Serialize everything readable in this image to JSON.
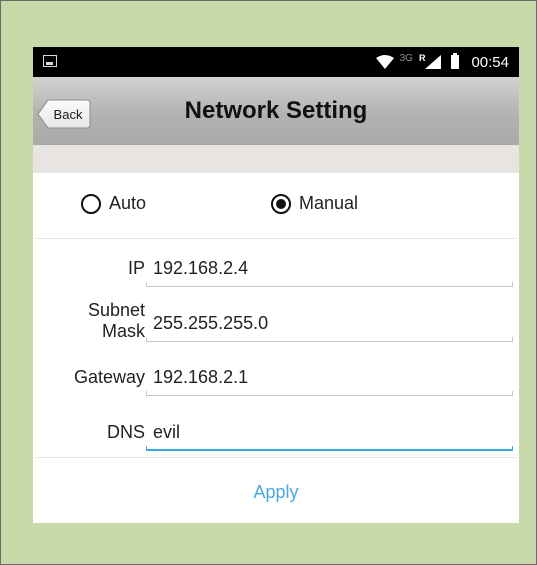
{
  "status_bar": {
    "network_label": "3G",
    "roaming_label": "R",
    "time": "00:54"
  },
  "header": {
    "back_label": "Back",
    "title": "Network Setting"
  },
  "mode": {
    "options": [
      "Auto",
      "Manual"
    ],
    "selected": "Manual"
  },
  "fields": {
    "ip": {
      "label": "IP",
      "value": "192.168.2.4"
    },
    "subnet": {
      "label_line1": "Subnet",
      "label_line2": "Mask",
      "value": "255.255.255.0"
    },
    "gateway": {
      "label": "Gateway",
      "value": "192.168.2.1"
    },
    "dns": {
      "label": "DNS",
      "value": "evil"
    }
  },
  "apply_label": "Apply",
  "colors": {
    "background": "#c8d9aa",
    "accent": "#4aa8e0",
    "status_bar": "#000000"
  }
}
